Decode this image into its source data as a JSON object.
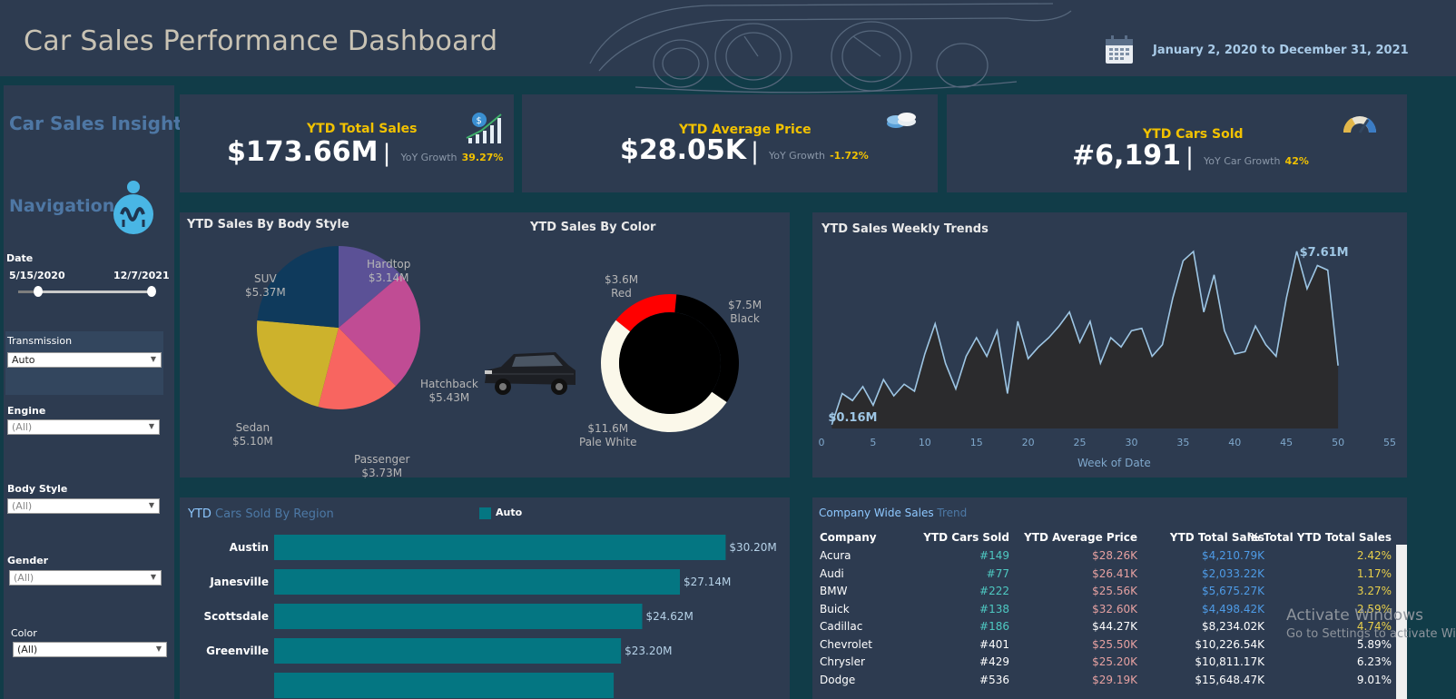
{
  "header": {
    "title": "Car Sales Performance Dashboard",
    "date_from": "January 2, 2020",
    "date_to_word": "to",
    "date_to": "December 31, 2021",
    "calendar_icon": "calendar-icon"
  },
  "sidebar": {
    "insight_title": "Car Sales Insight",
    "nav_title": "Navigation",
    "nav_icon": "info-person-icon",
    "date_label": "Date",
    "date_start": "5/15/2020",
    "date_end": "12/7/2021",
    "filters": [
      {
        "label": "Transmission",
        "value": "Auto"
      },
      {
        "label": "Engine",
        "value": "(All)"
      },
      {
        "label": "Body Style",
        "value": "(All)"
      },
      {
        "label": "Gender",
        "value": "(All)"
      },
      {
        "label": "Color",
        "value": "(All)"
      }
    ]
  },
  "kpis": {
    "sales": {
      "title": "YTD Total Sales",
      "value": "$173.66M",
      "sep": "|",
      "sub": "YoY Growth",
      "growth": "39.27%"
    },
    "price": {
      "title": "YTD Average Price",
      "value": "$28.05K",
      "sep": "|",
      "sub": "YoY Growth",
      "growth": "-1.72%"
    },
    "cars": {
      "title": "YTD Cars Sold",
      "value": "#6,191",
      "sep": "|",
      "sub": "YoY Car Growth",
      "growth": "42%"
    }
  },
  "colors": {
    "teal_bar": "#047682",
    "panel": "#2d3b50",
    "background": "#113c48",
    "accent_yellow": "#f2c200",
    "line": "#9ec6e4"
  },
  "chart_data": [
    {
      "type": "pie",
      "title": "YTD Sales By Body Style",
      "slices": [
        {
          "label": "Hardtop",
          "value_label": "$3.14M",
          "value": 3.14,
          "color": "#5b5196"
        },
        {
          "label": "Hatchback",
          "value_label": "$5.43M",
          "value": 5.43,
          "color": "#c04c94"
        },
        {
          "label": "Passenger",
          "value_label": "$3.73M",
          "value": 3.73,
          "color": "#f86560"
        },
        {
          "label": "Sedan",
          "value_label": "$5.10M",
          "value": 5.1,
          "color": "#cdb22c"
        },
        {
          "label": "SUV",
          "value_label": "$5.37M",
          "value": 5.37,
          "color": "#0f3a5c"
        }
      ]
    },
    {
      "type": "pie",
      "title": "YTD Sales By Color",
      "slices": [
        {
          "label": "Red",
          "value_label": "$3.6M",
          "value": 3.6,
          "color": "#ff0000"
        },
        {
          "label": "Black",
          "value_label": "$7.5M",
          "value": 7.5,
          "color": "#000000"
        },
        {
          "label": "Pale White",
          "value_label": "$11.6M",
          "value": 11.6,
          "color": "#fbf8ea"
        }
      ]
    },
    {
      "type": "area",
      "title": "YTD Sales Weekly Trends",
      "xlabel": "Week of Date",
      "xlim": [
        0,
        55
      ],
      "xticks": [
        0,
        5,
        10,
        15,
        20,
        25,
        30,
        35,
        40,
        45,
        50,
        55
      ],
      "ylim": [
        0,
        8.5
      ],
      "x": [
        1,
        2,
        3,
        4,
        5,
        6,
        7,
        8,
        9,
        10,
        11,
        12,
        13,
        14,
        15,
        16,
        17,
        18,
        19,
        20,
        21,
        22,
        23,
        24,
        25,
        26,
        27,
        28,
        29,
        30,
        31,
        32,
        33,
        34,
        35,
        36,
        37,
        38,
        39,
        40,
        41,
        42,
        43,
        44,
        45,
        46,
        47,
        48,
        49,
        50
      ],
      "values": [
        0.16,
        1.5,
        1.2,
        1.8,
        1.0,
        2.1,
        1.4,
        1.9,
        1.6,
        3.2,
        4.5,
        2.8,
        1.7,
        3.1,
        3.9,
        3.1,
        4.2,
        1.5,
        4.6,
        3.0,
        3.5,
        3.9,
        4.4,
        5.0,
        3.7,
        4.6,
        2.8,
        3.9,
        3.5,
        4.2,
        4.3,
        3.1,
        3.6,
        5.6,
        7.2,
        7.6,
        5.0,
        6.6,
        4.2,
        3.2,
        3.3,
        4.4,
        3.6,
        3.1,
        5.6,
        7.61,
        6.0,
        7.0,
        6.8,
        2.7
      ],
      "labels": [
        {
          "text": "$0.16M"
        },
        {
          "text": "$7.61M"
        }
      ]
    },
    {
      "type": "bar",
      "title_part1": "YTD",
      "title_part2": "Cars Sold By Region",
      "legend": "Auto",
      "categories": [
        "Austin",
        "Janesville",
        "Scottsdale",
        "Greenville"
      ],
      "values": [
        30.2,
        27.14,
        24.62,
        23.2
      ],
      "value_labels": [
        "$30.20M",
        "$27.14M",
        "$24.62M",
        "$23.20M"
      ],
      "xlim": [
        0,
        34
      ]
    }
  ],
  "company_table": {
    "title_part1": "Company Wide Sales",
    "title_part2": "Trend",
    "headers": [
      "Company",
      "YTD Cars Sold",
      "YTD Average Price",
      "YTD Total Sales",
      "% Total YTD Total Sales"
    ],
    "rows": [
      {
        "company": "Acura",
        "sold": "#149",
        "price": "$28.26K",
        "total": "$4,210.79K",
        "pct": "2.42%"
      },
      {
        "company": "Audi",
        "sold": "#77",
        "price": "$26.41K",
        "total": "$2,033.22K",
        "pct": "1.17%"
      },
      {
        "company": "BMW",
        "sold": "#222",
        "price": "$25.56K",
        "total": "$5,675.27K",
        "pct": "3.27%"
      },
      {
        "company": "Buick",
        "sold": "#138",
        "price": "$32.60K",
        "total": "$4,498.42K",
        "pct": "2.59%"
      },
      {
        "company": "Cadillac",
        "sold": "#186",
        "price": "$44.27K",
        "total": "$8,234.02K",
        "pct": "4.74%"
      },
      {
        "company": "Chevrolet",
        "sold": "#401",
        "price": "$25.50K",
        "total": "$10,226.54K",
        "pct": "5.89%"
      },
      {
        "company": "Chrysler",
        "sold": "#429",
        "price": "$25.20K",
        "total": "$10,811.17K",
        "pct": "6.23%"
      },
      {
        "company": "Dodge",
        "sold": "#536",
        "price": "$29.19K",
        "total": "$15,648.47K",
        "pct": "9.01%"
      }
    ]
  },
  "watermark": {
    "line1": "Activate Windows",
    "line2": "Go to Settings to activate Windows."
  }
}
